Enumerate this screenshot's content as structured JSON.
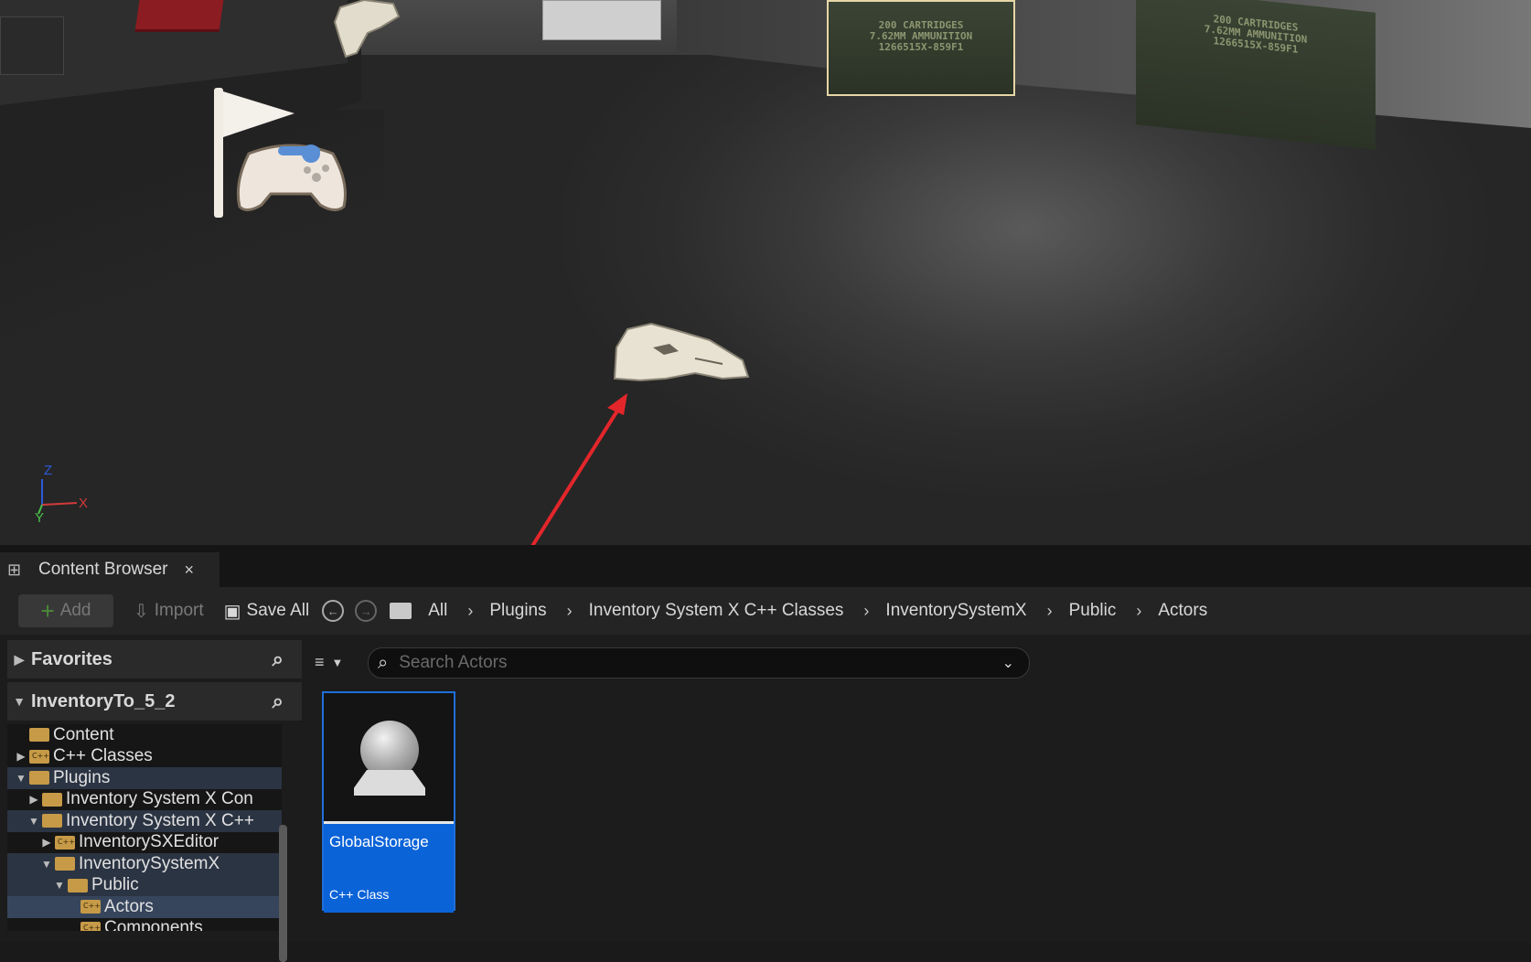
{
  "viewport": {
    "ammo_box_1": [
      "200 CARTRIDGES",
      "7.62MM AMMUNITION",
      "1266515X-859F1"
    ],
    "ammo_box_2": [
      "200 CARTRIDGES",
      "7.62MM AMMUNITION",
      "1266515X-859F1"
    ],
    "gizmo": {
      "x": "X",
      "y": "Y",
      "z": "Z"
    }
  },
  "tab": {
    "title": "Content Browser",
    "close": "×"
  },
  "toolbar": {
    "add_label": "Add",
    "import_label": "Import",
    "save_all_label": "Save All"
  },
  "breadcrumbs": [
    "All",
    "Plugins",
    "Inventory System X C++ Classes",
    "InventorySystemX",
    "Public",
    "Actors"
  ],
  "sidebar": {
    "favorites_label": "Favorites",
    "project_label": "InventoryTo_5_2",
    "tree": [
      {
        "label": "Content",
        "depth": 0,
        "expanded": "none",
        "cpp": false
      },
      {
        "label": "C++ Classes",
        "depth": 0,
        "expanded": "collapsed",
        "cpp": true
      },
      {
        "label": "Plugins",
        "depth": 0,
        "expanded": "expanded",
        "cpp": false
      },
      {
        "label": "Inventory System X Con",
        "depth": 1,
        "expanded": "collapsed",
        "cpp": false
      },
      {
        "label": "Inventory System X C++",
        "depth": 1,
        "expanded": "expanded",
        "cpp": false
      },
      {
        "label": "InventorySXEditor",
        "depth": 2,
        "expanded": "collapsed",
        "cpp": true
      },
      {
        "label": "InventorySystemX",
        "depth": 2,
        "expanded": "expanded",
        "cpp": false
      },
      {
        "label": "Public",
        "depth": 3,
        "expanded": "expanded",
        "cpp": false
      },
      {
        "label": "Actors",
        "depth": 4,
        "expanded": "none",
        "cpp": true
      },
      {
        "label": "Components",
        "depth": 4,
        "expanded": "none",
        "cpp": true
      }
    ]
  },
  "search": {
    "placeholder": "Search Actors"
  },
  "assets": [
    {
      "name": "GlobalStorage",
      "type": "C++ Class"
    }
  ],
  "colors": {
    "selection": "#0b63d8",
    "arrow": "#e3262b"
  }
}
